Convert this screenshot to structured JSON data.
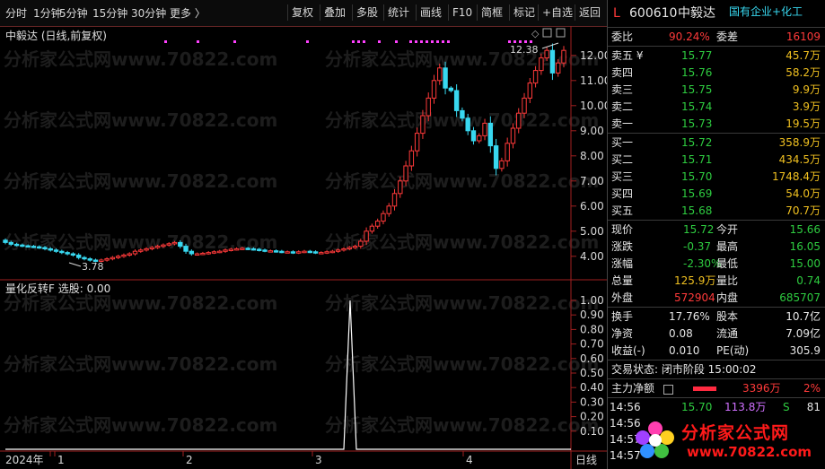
{
  "toolbar": {
    "left": [
      "分时",
      "1分钟",
      "5分钟",
      "15分钟",
      "30分钟",
      "更多 〉"
    ],
    "right": [
      "复权",
      "叠加",
      "多股",
      "统计",
      "画线",
      "F10",
      "简框",
      "标记",
      "+自选",
      "返回"
    ]
  },
  "chart": {
    "title": "中毅达 (日线,前复权)",
    "high_label": "12.38",
    "low_label": "3.78",
    "price_ticks": [
      "12.00",
      "11.00",
      "10.00",
      "9.00",
      "8.00",
      "7.00",
      "6.00",
      "5.00",
      "4.00"
    ],
    "indicator_title": "量化反转F  选股: 0.00",
    "indicator_ticks": [
      "1.00",
      "0.90",
      "0.80",
      "0.70",
      "0.60",
      "0.50",
      "0.40",
      "0.30",
      "0.20",
      "0.10"
    ],
    "date_labels": [
      "2024年",
      "1",
      "2",
      "3",
      "4"
    ],
    "period": "日线",
    "watermark": "分析家公式网www.70822.com",
    "colors": {
      "up": "#ff3a3a",
      "down": "#38d8f0",
      "signal": "#ff40ff",
      "axis": "#c33"
    }
  },
  "chart_data": {
    "type": "candlestick",
    "title": "中毅达 (日线,前复权)",
    "ylim": [
      3.6,
      12.6
    ],
    "annotations": [
      "12.38",
      "3.78"
    ],
    "close": [
      4.55,
      4.48,
      4.45,
      4.42,
      4.4,
      4.38,
      4.35,
      4.3,
      4.25,
      4.2,
      4.15,
      4.1,
      4.05,
      3.95,
      3.9,
      3.85,
      3.82,
      3.85,
      3.9,
      3.95,
      4.0,
      4.05,
      4.1,
      4.2,
      4.25,
      4.3,
      4.35,
      4.4,
      4.45,
      4.5,
      4.55,
      4.4,
      4.2,
      4.1,
      4.1,
      4.12,
      4.15,
      4.18,
      4.2,
      4.25,
      4.28,
      4.3,
      4.32,
      4.3,
      4.28,
      4.25,
      4.22,
      4.22,
      4.2,
      4.18,
      4.18,
      4.15,
      4.18,
      4.2,
      4.18,
      4.15,
      4.15,
      4.18,
      4.2,
      4.25,
      4.3,
      4.35,
      4.4,
      4.6,
      5.0,
      5.2,
      5.4,
      5.7,
      6.0,
      6.5,
      7.0,
      7.6,
      8.2,
      8.9,
      9.6,
      10.3,
      11.0,
      11.5,
      10.7,
      10.6,
      9.8,
      9.5,
      9.0,
      8.6,
      8.8,
      9.3,
      8.4,
      7.5,
      7.8,
      8.5,
      9.1,
      9.7,
      10.3,
      10.9,
      11.4,
      11.9,
      12.2,
      11.3,
      11.7,
      12.2
    ],
    "indicator": {
      "name": "量化反转F",
      "value": 0.0,
      "peak": 1.0
    }
  },
  "panel": {
    "code": "600610",
    "name": "中毅达",
    "tag": "国有企业+化工",
    "weibi_label": "委比",
    "weibi": "90.24%",
    "weicha_label": "委差",
    "weicha": "16109",
    "sells": [
      {
        "label": "卖五 ¥",
        "price": "15.77",
        "vol": "45.7万"
      },
      {
        "label": "卖四",
        "price": "15.76",
        "vol": "58.2万"
      },
      {
        "label": "卖三",
        "price": "15.75",
        "vol": "9.9万"
      },
      {
        "label": "卖二",
        "price": "15.74",
        "vol": "3.9万"
      },
      {
        "label": "卖一",
        "price": "15.73",
        "vol": "19.5万"
      }
    ],
    "buys": [
      {
        "label": "买一",
        "price": "15.72",
        "vol": "358.9万"
      },
      {
        "label": "买二",
        "price": "15.71",
        "vol": "434.5万"
      },
      {
        "label": "买三",
        "price": "15.70",
        "vol": "1748.4万"
      },
      {
        "label": "买四",
        "price": "15.69",
        "vol": "54.0万"
      },
      {
        "label": "买五",
        "price": "15.68",
        "vol": "70.7万"
      }
    ],
    "quote": [
      {
        "l1": "现价",
        "v1": "15.72",
        "c1": "green",
        "l2": "今开",
        "v2": "15.66",
        "c2": "green"
      },
      {
        "l1": "涨跌",
        "v1": "-0.37",
        "c1": "green",
        "l2": "最高",
        "v2": "16.05",
        "c2": "green"
      },
      {
        "l1": "涨幅",
        "v1": "-2.30%",
        "c1": "green",
        "l2": "最低",
        "v2": "15.00",
        "c2": "green"
      },
      {
        "l1": "总量",
        "v1": "125.9万",
        "c1": "yellow",
        "l2": "量比",
        "v2": "0.74",
        "c2": "green"
      },
      {
        "l1": "外盘",
        "v1": "572904",
        "c1": "red",
        "l2": "内盘",
        "v2": "685707",
        "c2": "green"
      }
    ],
    "fund": [
      {
        "l1": "换手",
        "v1": "17.76%",
        "l2": "股本",
        "v2": "10.7亿"
      },
      {
        "l1": "净资",
        "v1": "0.08",
        "l2": "流通",
        "v2": "7.09亿"
      },
      {
        "l1": "收益(-)",
        "v1": "0.010",
        "l2": "PE(动)",
        "v2": "305.9"
      }
    ],
    "trade_status": "交易状态: 闭市阶段 15:00:02",
    "main_force_label": "主力净额",
    "main_force_value": "3396万",
    "main_force_pct": "2%",
    "ticks": [
      {
        "time": "14:56",
        "price": "15.70",
        "vol": "113.8万",
        "side": "S",
        "num": "81"
      },
      {
        "time": "14:56",
        "price": "",
        "vol": "",
        "side": "",
        "num": ""
      },
      {
        "time": "14:57",
        "price": "",
        "vol": "",
        "side": "",
        "num": ""
      },
      {
        "time": "14:57",
        "price": "",
        "vol": "",
        "side": "",
        "num": ""
      }
    ],
    "logo_text": "分析家公式网",
    "logo_url": "www.70822.com"
  }
}
